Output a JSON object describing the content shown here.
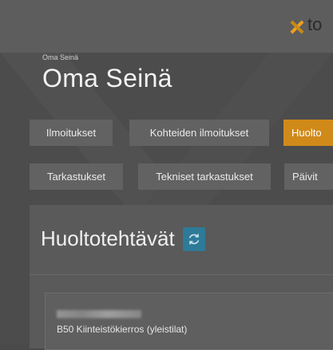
{
  "header": {
    "logo_text": "to"
  },
  "page": {
    "breadcrumb": "Oma Seinä",
    "title": "Oma Seinä"
  },
  "tabs_row1": [
    {
      "label": "Ilmoitukset",
      "active": false
    },
    {
      "label": "Kohteiden ilmoitukset",
      "active": false
    },
    {
      "label": "Huolto",
      "active": true
    }
  ],
  "tabs_row2": [
    {
      "label": "Tarkastukset",
      "active": false
    },
    {
      "label": "Tekniset tarkastukset",
      "active": false
    },
    {
      "label": "Päivit",
      "active": false
    }
  ],
  "card": {
    "title": "Huoltotehtävät",
    "refresh_icon": "refresh-icon"
  },
  "task": {
    "name": "B50 Kiinteistökierros (yleistilat)"
  },
  "colors": {
    "accent_active_tab": "#d08a19",
    "refresh_button": "#2d7b98",
    "logo_orange": "#f0a020"
  }
}
